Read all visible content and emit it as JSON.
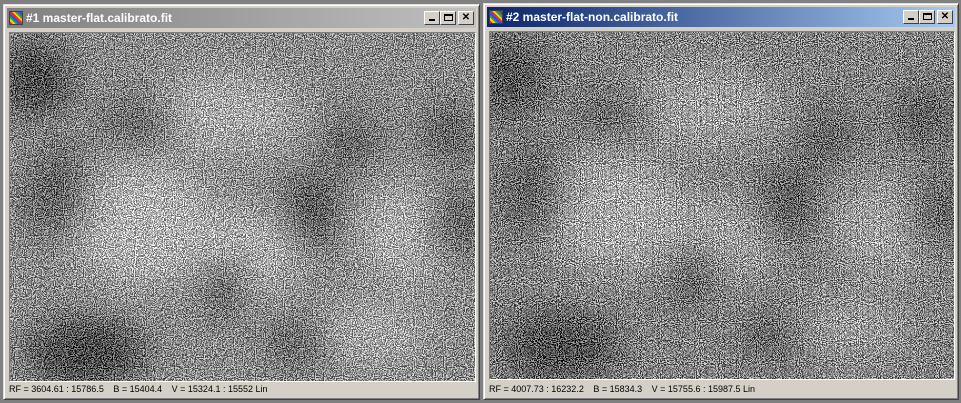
{
  "windows": [
    {
      "title": "#1 master-flat.calibrato.fit",
      "active": false,
      "status": {
        "rf": "RF = 3604.61 : 15786.5",
        "b": "B = 15404.4",
        "v": "V = 15324.1 : 15552 Lin"
      }
    },
    {
      "title": "#2 master-flat-non.calibrato.fit",
      "active": true,
      "status": {
        "rf": "RF = 4007.73 : 16232.2",
        "b": "B = 15834.3",
        "v": "V = 15755.6 : 15987.5 Lin"
      }
    }
  ],
  "colors": {
    "active_title": "#0a246a",
    "inactive_title": "#808080",
    "window_face": "#d4d0c8"
  },
  "icons": {
    "app": "palette-icon",
    "minimize": "minimize-icon",
    "maximize": "maximize-icon",
    "close": "close-icon"
  }
}
